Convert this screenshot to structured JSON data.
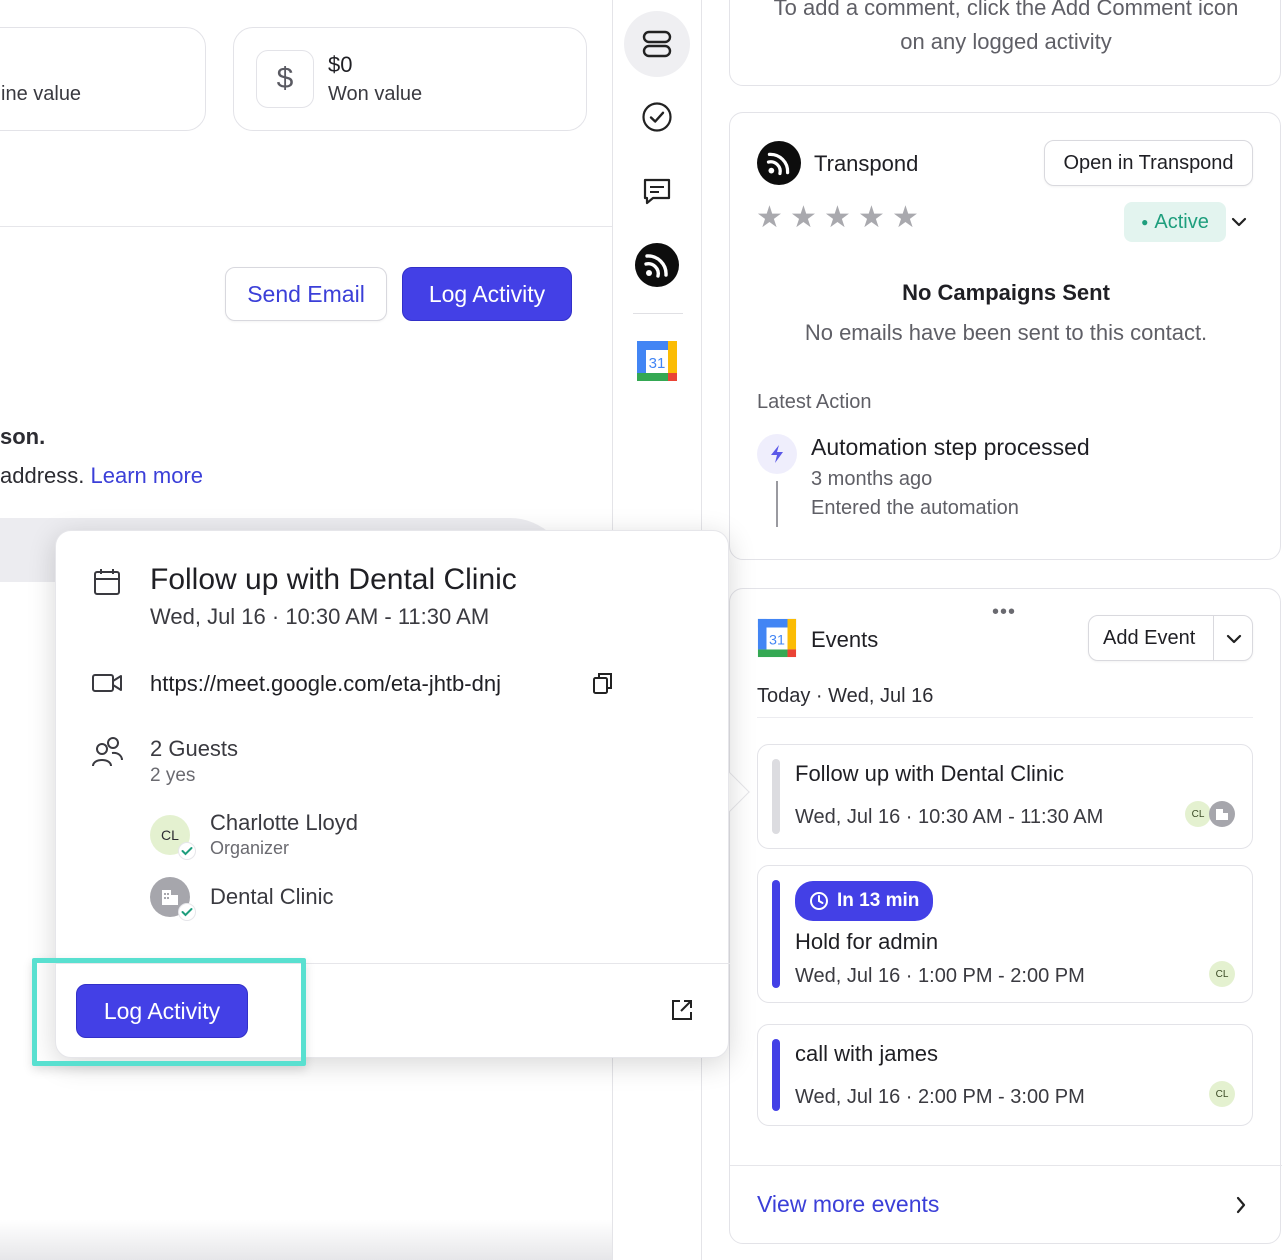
{
  "stats": {
    "pipeline_label": "ine value",
    "won_value": "$0",
    "won_label": "Won value",
    "dollar_symbol": "$"
  },
  "actions": {
    "send_email": "Send Email",
    "log_activity": "Log Activity"
  },
  "info": {
    "line1": "son.",
    "line2": "address.",
    "learn_more": "Learn more"
  },
  "comment_hint": "To add a comment, click the Add Comment icon on any logged activity",
  "transpond": {
    "name": "Transpond",
    "open_button": "Open in Transpond",
    "status": "Active",
    "rating": 0,
    "max_rating": 5,
    "empty_title": "No Campaigns Sent",
    "empty_text": "No emails have been sent to this contact.",
    "latest_label": "Latest Action",
    "latest_title": "Automation step processed",
    "latest_time": "3 months ago",
    "latest_detail": "Entered the automation"
  },
  "events": {
    "title": "Events",
    "add_button": "Add Event",
    "date_header": "Today · Wed, Jul 16",
    "items": [
      {
        "title": "Follow up with Dental Clinic",
        "time": "Wed, Jul 16 · 10:30 AM - 11:30 AM",
        "avatar": "CL"
      },
      {
        "badge": "In 13 min",
        "title": "Hold for admin",
        "time": "Wed, Jul 16 · 1:00 PM - 2:00 PM",
        "avatar": "CL"
      },
      {
        "title": "call with james",
        "time": "Wed, Jul 16 · 2:00 PM - 3:00 PM",
        "avatar": "CL"
      }
    ],
    "view_more": "View more events"
  },
  "popover": {
    "title": "Follow up with Dental Clinic",
    "datetime": "Wed, Jul 16 · 10:30 AM - 11:30 AM",
    "meet_link": "https://meet.google.com/eta-jhtb-dnj",
    "guests_count": "2 Guests",
    "guests_rsvp": "2 yes",
    "guests": [
      {
        "initials": "CL",
        "name": "Charlotte Lloyd",
        "role": "Organizer"
      },
      {
        "initials": "",
        "name": "Dental Clinic",
        "role": ""
      }
    ],
    "log_activity": "Log Activity"
  },
  "calendar_icon_day": "31",
  "colors": {
    "primary": "#4340e6",
    "link": "#3b3fd8",
    "active_green": "#1e9e7d",
    "highlight": "#59e0d0"
  }
}
